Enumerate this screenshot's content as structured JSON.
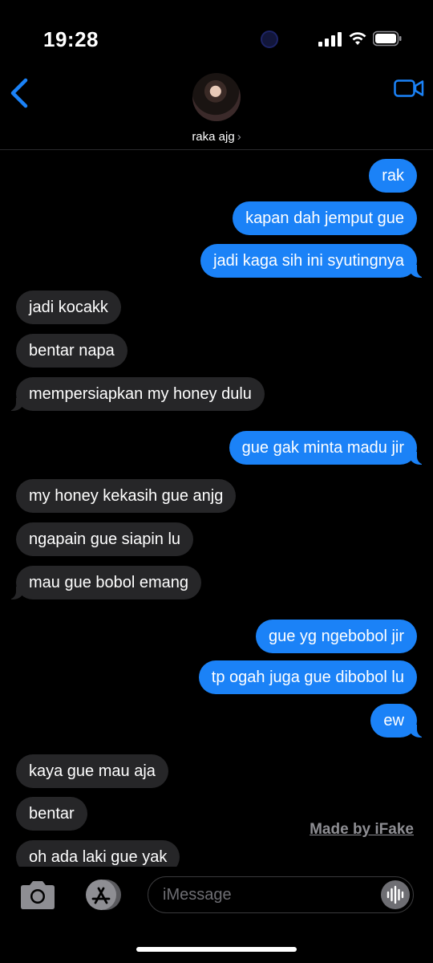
{
  "status_bar": {
    "time": "19:28"
  },
  "header": {
    "contact_name": "raka ajg",
    "chevron": "›"
  },
  "messages": [
    {
      "dir": "out",
      "text": "rak"
    },
    {
      "dir": "out",
      "text": "kapan dah jemput gue"
    },
    {
      "dir": "out",
      "text": "jadi kaga sih ini syutingnya"
    },
    {
      "dir": "in",
      "text": "jadi kocakk"
    },
    {
      "dir": "in",
      "text": "bentar napa"
    },
    {
      "dir": "in",
      "text": "mempersiapkan my honey dulu"
    },
    {
      "dir": "out",
      "text": "gue gak minta madu jir"
    },
    {
      "dir": "in",
      "text": "my honey kekasih gue anjg"
    },
    {
      "dir": "in",
      "text": "ngapain gue siapin lu"
    },
    {
      "dir": "in",
      "text": "mau gue bobol emang"
    },
    {
      "dir": "out",
      "text": "gue yg ngebobol jir"
    },
    {
      "dir": "out",
      "text": "tp ogah juga gue dibobol lu"
    },
    {
      "dir": "out",
      "text": "ew"
    },
    {
      "dir": "in",
      "text": "kaya gue mau aja"
    },
    {
      "dir": "in",
      "text": "bentar"
    },
    {
      "dir": "in",
      "text": "oh ada laki gue yak"
    }
  ],
  "watermark": "Made by iFake",
  "composer": {
    "placeholder": "iMessage"
  },
  "colors": {
    "accent": "#1b82f7",
    "incoming_bubble": "#262628",
    "background": "#000000"
  },
  "icons": [
    "back-chevron-icon",
    "video-camera-icon",
    "camera-icon",
    "app-store-icon",
    "audio-waveform-icon",
    "signal-icon",
    "wifi-icon",
    "battery-icon"
  ]
}
